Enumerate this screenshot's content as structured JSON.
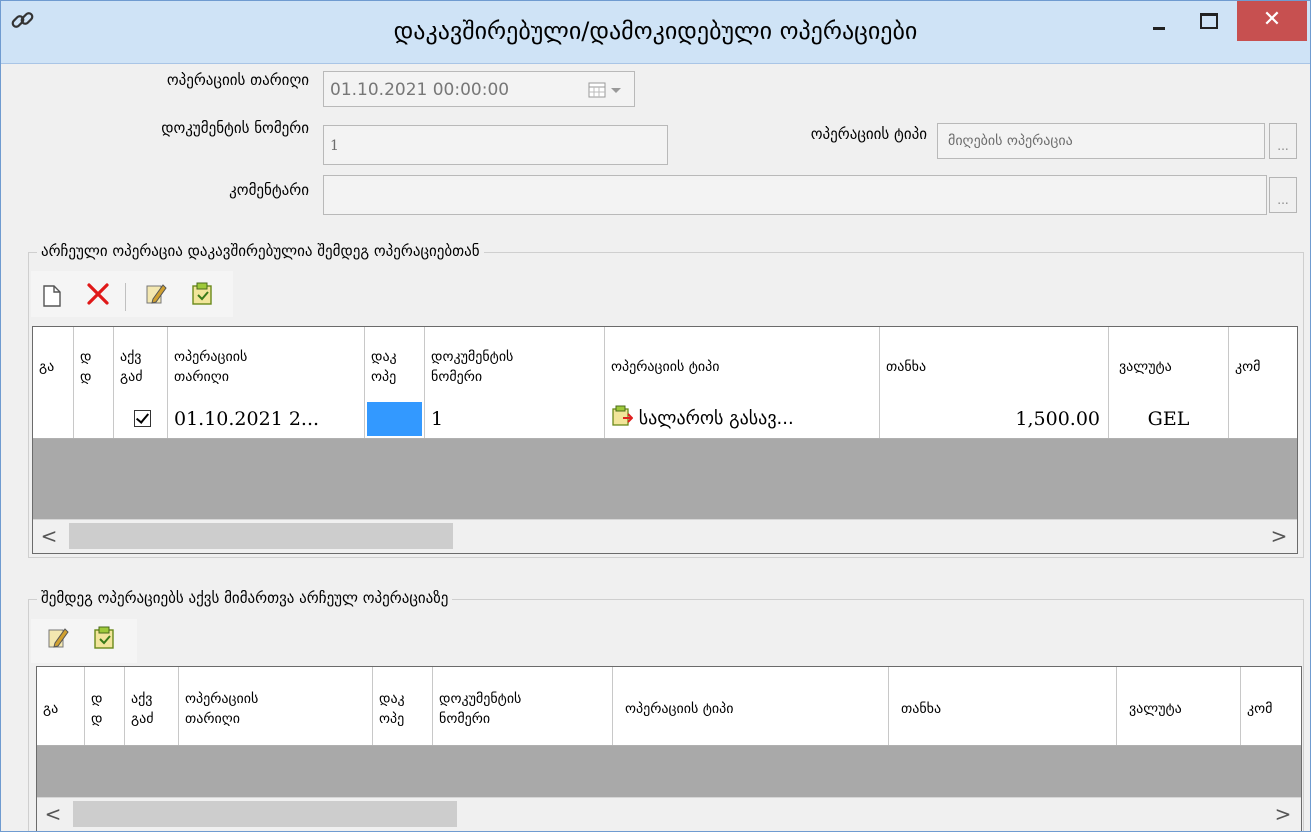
{
  "window": {
    "title": "დაკავშირებული/დამოკიდებული ოპერაციები",
    "close_label": "✕"
  },
  "form": {
    "date_label": "ოპერაციის თარიღი",
    "date_value": "01.10.2021 00:00:00",
    "doc_number_label": "დოკუმენტის ნომერი",
    "doc_number_value": "1",
    "op_type_label": "ოპერაციის ტიპი",
    "op_type_value": "მიღების ოპერაცია",
    "comment_label": "კომენტარი",
    "comment_value": "",
    "dots_label": "..."
  },
  "section1": {
    "title": "არჩეული ოპერაცია დაკავშირებულია შემდეგ ოპერაციებთან",
    "columns": [
      "გა",
      "დ\nდ",
      "აქვ\nგაძ",
      "ოპერაციის\nთარიღი",
      "დაკ\nოპე",
      "დოკუმენტის\nნომერი",
      "ოპერაციის ტიპი",
      "თანხა",
      "ვალუტა",
      "კომ"
    ],
    "rows": [
      {
        "col_ga": "",
        "col_d": "",
        "checked": true,
        "date": "01.10.2021 2...",
        "status_color": "#3399ff",
        "doc_number": "1",
        "op_type": "სალაროს გასავ...",
        "amount": "1,500.00",
        "currency": "GEL",
        "comment": ""
      }
    ]
  },
  "section2": {
    "title": "შემდეგ ოპერაციებს აქვს მიმართვა არჩეულ ოპერაციაზე",
    "columns": [
      "გა",
      "დ\nდ",
      "აქვ\nგაძ",
      "ოპერაციის\nთარიღი",
      "დაკ\nოპე",
      "დოკუმენტის\nნომერი",
      "ოპერაციის ტიპი",
      "თანხა",
      "ვალუტა",
      "კომ"
    ]
  },
  "scroll": {
    "left": "<",
    "right": ">"
  }
}
